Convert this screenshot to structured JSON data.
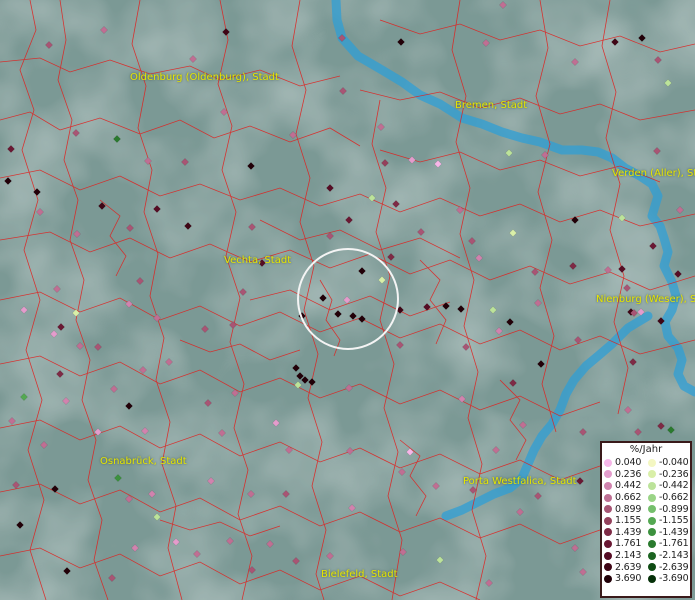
{
  "cities": [
    {
      "id": "oldenburg",
      "name": "Oldenburg (Oldenburg), Stadt"
    },
    {
      "id": "bremen",
      "name": "Bremen, Stadt"
    },
    {
      "id": "verden",
      "name": "Verden (Aller), St"
    },
    {
      "id": "vechta",
      "name": "Vechta, Stadt"
    },
    {
      "id": "nienburg",
      "name": "Nienburg (Weser), St"
    },
    {
      "id": "osnabrueck",
      "name": "Osnabrück, Stadt"
    },
    {
      "id": "porta",
      "name": "Porta Westfalica, Stadt"
    },
    {
      "id": "bielefeld",
      "name": "Bielefeld, Stadt"
    }
  ],
  "legend": {
    "title": "%/Jahr",
    "positive": [
      "0.040",
      "0.236",
      "0.442",
      "0.662",
      "0.899",
      "1.155",
      "1.439",
      "1.761",
      "2.143",
      "2.639",
      "3.690"
    ],
    "negative": [
      "-0.040",
      "-0.236",
      "-0.442",
      "-0.662",
      "-0.899",
      "-1.155",
      "-1.439",
      "-1.761",
      "-2.143",
      "-2.639",
      "-3.690"
    ],
    "positive_colors": [
      "#f7b6e8",
      "#e49ccc",
      "#d183ae",
      "#bf6f93",
      "#a85574",
      "#94405b",
      "#7e2a45",
      "#6a1833",
      "#560c24",
      "#3f0515",
      "#220008"
    ],
    "negative_colors": [
      "#f4f7c2",
      "#d9efa8",
      "#bce39a",
      "#9ad486",
      "#75bf6c",
      "#54a852",
      "#3c913e",
      "#2a7a2e",
      "#1c6421",
      "#0e4b13",
      "#053008"
    ]
  }
}
